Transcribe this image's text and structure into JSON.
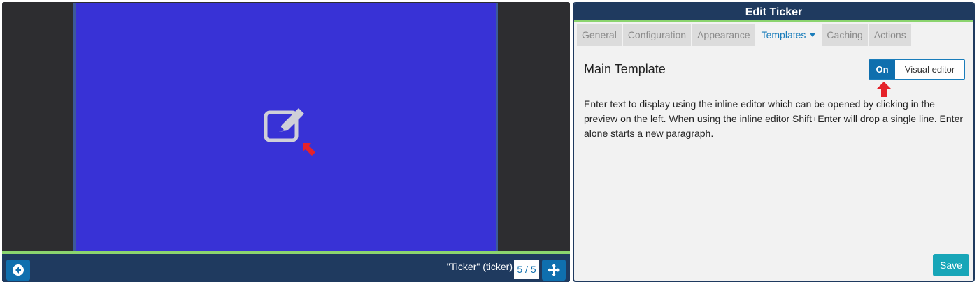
{
  "preview": {
    "canvas_color": "#3832d6",
    "ticker_label": "\"Ticker\" (ticker)",
    "page_count": "5 / 5",
    "icons": {
      "edit": "edit-square-icon",
      "back": "back-arrow-circle-icon",
      "move": "move-arrows-icon",
      "pointer": "red-arrow-icon"
    }
  },
  "panel": {
    "title": "Edit Ticker",
    "tabs": [
      {
        "label": "General"
      },
      {
        "label": "Configuration"
      },
      {
        "label": "Appearance"
      },
      {
        "label": "Templates",
        "active": true
      },
      {
        "label": "Caching"
      },
      {
        "label": "Actions"
      }
    ],
    "section_title": "Main Template",
    "toggle": {
      "on_label": "On",
      "off_label": "Visual editor"
    },
    "description": "Enter text to display using the inline editor which can be opened by clicking in the preview on the left. When using the inline editor Shift+Enter will drop a single line. Enter alone starts a new paragraph.",
    "save_label": "Save"
  },
  "colors": {
    "header": "#1f3a5f",
    "accent_green": "#8bd46e",
    "primary_blue": "#0f6fae",
    "save_teal": "#18a6b8"
  }
}
